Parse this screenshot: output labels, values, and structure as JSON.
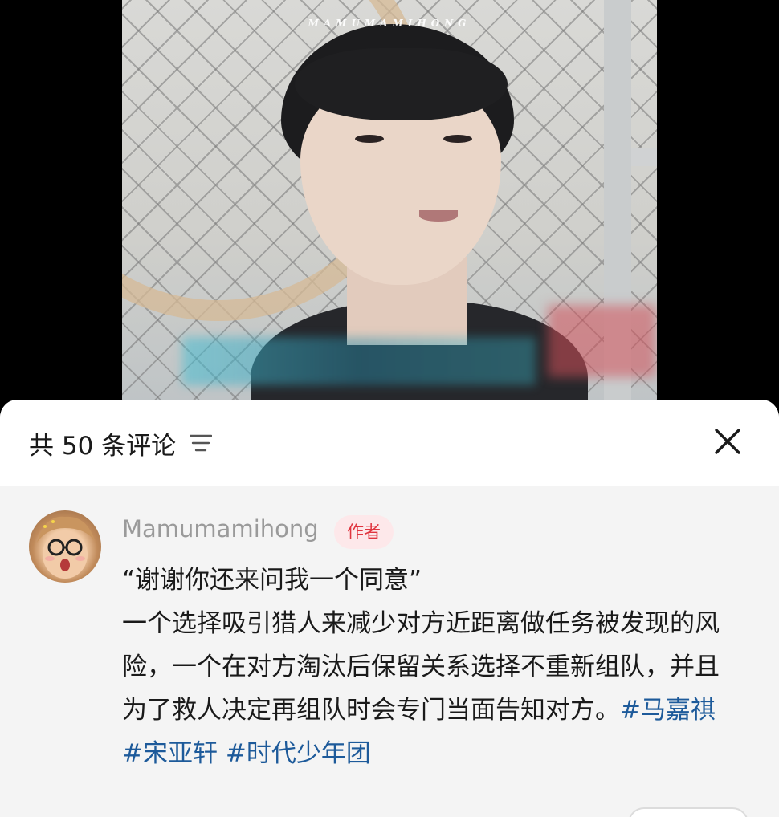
{
  "video": {
    "watermark": "MAMUMAMIHONG"
  },
  "header": {
    "comment_count_label": "共 50 条评论",
    "sort_icon": "sort-lines-icon",
    "close_icon": "close-icon"
  },
  "comment": {
    "username": "Mamumamihong",
    "author_badge": "作者",
    "line_quote": "“谢谢你还来问我一个同意”",
    "body": "一个选择吸引猎人来减少对方近距离做任务被发现的风险，一个在对方淘汰后保留关系选择不重新组队，并且为了救人决定再组队时会专门当面告知对方。",
    "hashtags": [
      "#马嘉祺",
      "#宋亚轩",
      "#时代少年团"
    ],
    "hashtag_color": "#1d5a9a"
  },
  "colors": {
    "badge_bg": "#fde8ea",
    "badge_text": "#e0353f",
    "comment_bg": "#f4f4f4"
  }
}
